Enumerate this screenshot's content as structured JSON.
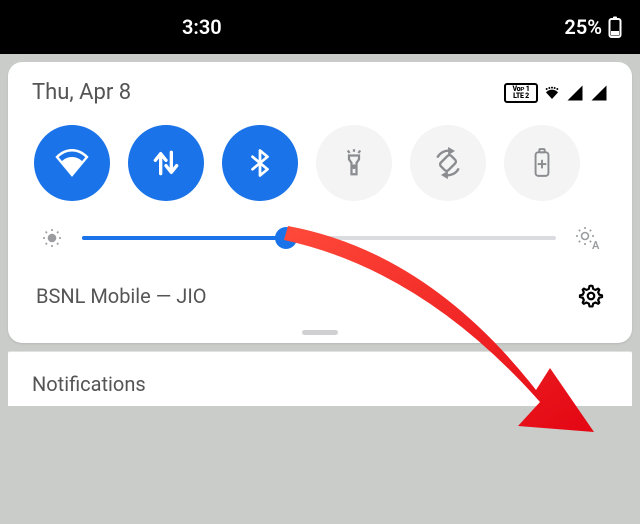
{
  "status": {
    "time": "3:30",
    "battery_pct": "25%"
  },
  "panel": {
    "date": "Thu, Apr 8",
    "volte_line1": "Voᴩ 1",
    "volte_line2": "LTE 2",
    "tiles": {
      "wifi": "on",
      "data": "on",
      "bluetooth": "on",
      "flashlight": "off",
      "autorotate": "off",
      "battery_saver": "off"
    },
    "brightness_pct": 43,
    "carrier": "BSNL Mobile — JIO"
  },
  "notifications_header": "Notifications"
}
